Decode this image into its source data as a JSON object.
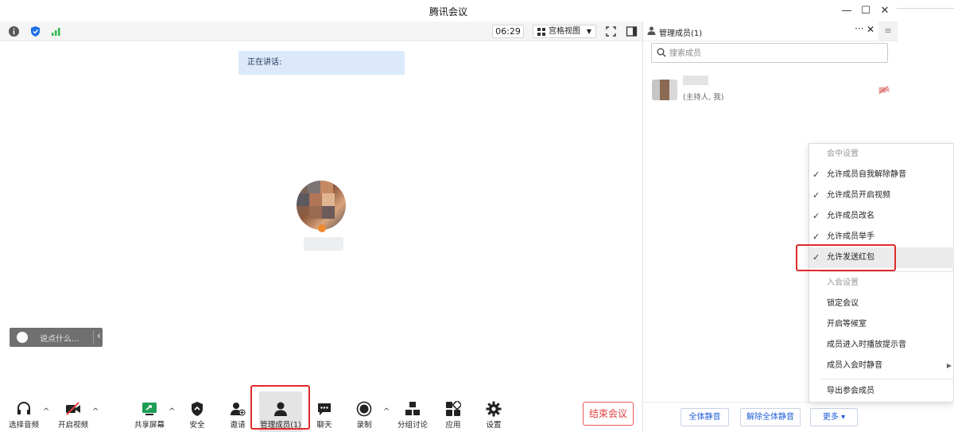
{
  "window": {
    "title": "腾讯会议",
    "minimize": "—",
    "maximize": "☐",
    "close": "✕"
  },
  "toolbar": {
    "timer": "06:29",
    "view_label": "宫格视图"
  },
  "video": {
    "speaking_label": "正在讲话:",
    "chat_placeholder": "说点什么..."
  },
  "bottom": {
    "items": [
      {
        "label": "选择音频"
      },
      {
        "label": "开启视频"
      },
      {
        "label": "共享屏幕"
      },
      {
        "label": "安全"
      },
      {
        "label": "邀请"
      },
      {
        "label": "管理成员(1)"
      },
      {
        "label": "聊天"
      },
      {
        "label": "录制"
      },
      {
        "label": "分组讨论"
      },
      {
        "label": "应用"
      },
      {
        "label": "设置"
      }
    ],
    "end_label": "结束会议"
  },
  "panel": {
    "title": "管理成员(1)",
    "more": "···",
    "close": "✕",
    "menu": "≡",
    "search_placeholder": "搜索成员",
    "member_role": "(主持人, 我)",
    "footer": {
      "mute_all": "全体静音",
      "unmute_all": "解除全体静音",
      "more": "更多 ▾"
    }
  },
  "dropdown": {
    "section1": "会中设置",
    "items1": [
      {
        "label": "允许成员自我解除静音",
        "checked": true
      },
      {
        "label": "允许成员开启视频",
        "checked": true
      },
      {
        "label": "允许成员改名",
        "checked": true
      },
      {
        "label": "允许成员举手",
        "checked": true
      },
      {
        "label": "允许发送红包",
        "checked": true
      }
    ],
    "section2": "入会设置",
    "items2": [
      {
        "label": "锁定会议"
      },
      {
        "label": "开启等候室"
      },
      {
        "label": "成员进入时播放提示音"
      },
      {
        "label": "成员入会时静音"
      }
    ],
    "export": "导出参会成员",
    "check_glyph": "✓"
  },
  "colors": {
    "accent": "#1f5bd8",
    "end_red": "#e04040",
    "highlight_red": "#e02a2a",
    "speaking_bg": "#dbe9fb"
  }
}
